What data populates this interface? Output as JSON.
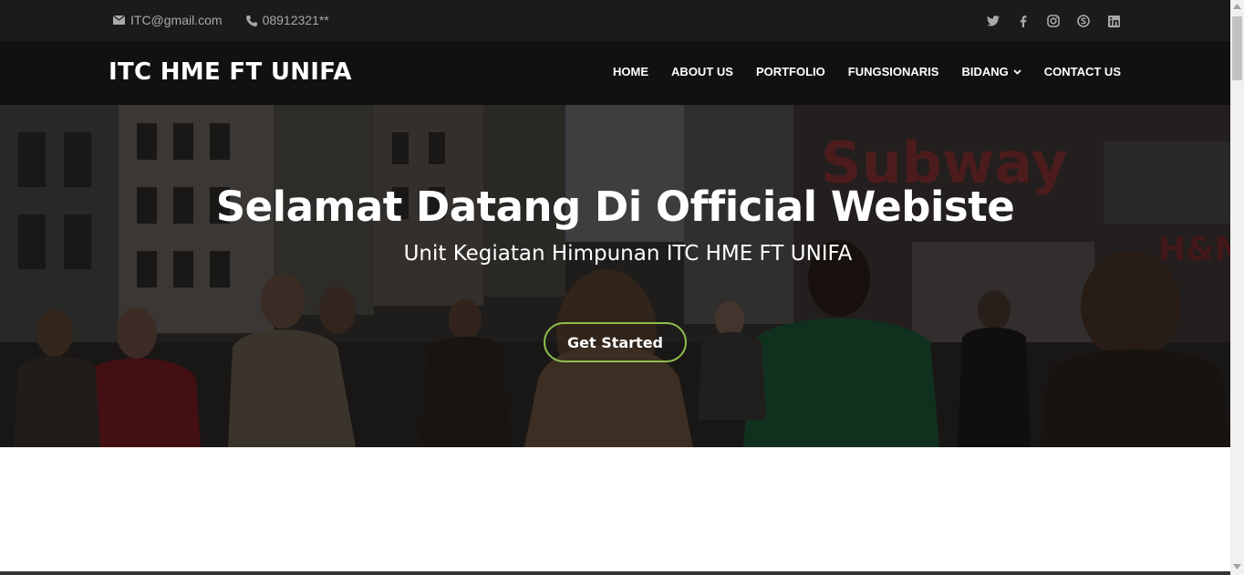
{
  "topbar": {
    "email": "ITC@gmail.com",
    "phone": "08912321**",
    "social_icons": [
      "twitter-icon",
      "facebook-icon",
      "instagram-icon",
      "skype-icon",
      "linkedin-icon"
    ]
  },
  "navbar": {
    "logo": "ITC HME FT UNIFA",
    "items": [
      {
        "label": "HOME"
      },
      {
        "label": "ABOUT US"
      },
      {
        "label": "PORTFOLIO"
      },
      {
        "label": "FUNGSIONARIS"
      },
      {
        "label": "BIDANG"
      },
      {
        "label": "CONTACT US"
      }
    ]
  },
  "hero": {
    "title": "Selamat Datang Di Official Webiste",
    "subtitle": "Unit Kegiatan Himpunan ITC HME FT UNIFA",
    "cta_label": "Get Started"
  },
  "colors": {
    "topbar_bg": "#1b1b1b",
    "navbar_bg": "#111111",
    "accent_border": "#8fbf4d"
  }
}
